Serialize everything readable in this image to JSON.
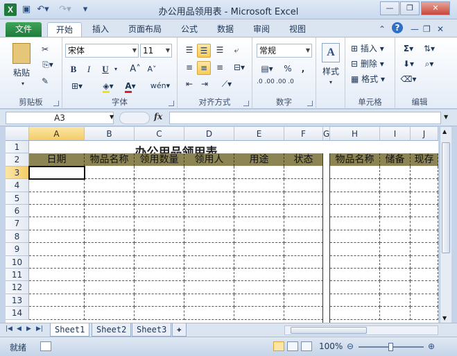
{
  "window": {
    "title": "办公用品领用表 - Microsoft Excel",
    "app_icon_letter": "X"
  },
  "tabs": [
    "文件",
    "开始",
    "插入",
    "页面布局",
    "公式",
    "数据",
    "审阅",
    "视图"
  ],
  "ribbon": {
    "clipboard": {
      "label": "剪贴板",
      "paste": "粘贴"
    },
    "font": {
      "label": "字体",
      "name": "宋体",
      "size": "11",
      "bold": "B",
      "italic": "I",
      "underline": "U"
    },
    "alignment": {
      "label": "对齐方式"
    },
    "number": {
      "label": "数字",
      "format": "常规",
      "percent": "%",
      "comma": ",",
      "inc_decimal": ".0 .00",
      "dec_decimal": ".00 .0"
    },
    "styles": {
      "label": "样式"
    },
    "cells": {
      "label": "单元格",
      "insert": "插入",
      "delete": "删除",
      "format": "格式"
    },
    "editing": {
      "label": "编辑",
      "sum": "Σ"
    }
  },
  "formula_bar": {
    "name_box": "A3",
    "fx": "fx",
    "content": ""
  },
  "grid": {
    "columns": [
      "A",
      "B",
      "C",
      "D",
      "E",
      "F",
      "G",
      "H",
      "I",
      "J"
    ],
    "selected_column": "A",
    "rows": [
      "1",
      "2",
      "3",
      "4",
      "5",
      "6",
      "7",
      "8",
      "9",
      "10",
      "11",
      "12",
      "13",
      "14"
    ],
    "selected_row": "3",
    "title": "办公用品领用表",
    "header_left": [
      "日期",
      "物品名称",
      "领用数量",
      "领用人",
      "用途",
      "状态"
    ],
    "header_right": [
      "物品名称",
      "储备",
      "现存"
    ],
    "header_color": "#8d8454"
  },
  "sheets": [
    "Sheet1",
    "Sheet2",
    "Sheet3"
  ],
  "active_sheet": "Sheet1",
  "status": {
    "ready": "就绪",
    "zoom": "100%"
  }
}
